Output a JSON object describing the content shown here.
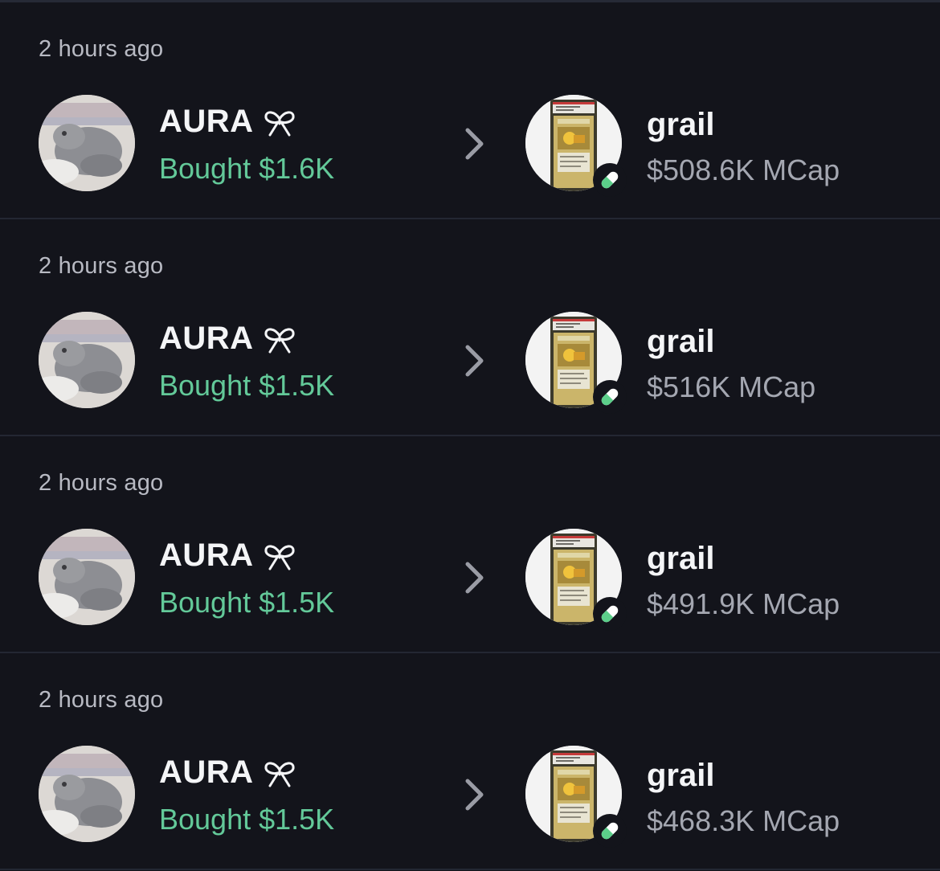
{
  "colors": {
    "background": "#13141b",
    "divider": "#232733",
    "action_green": "#63c999",
    "muted_text": "#a4a7b1",
    "primary_text": "#f4f5f7"
  },
  "icons": {
    "trader_badge": "ribbon-icon",
    "arrow": "chevron-right-icon",
    "token_badge": "pill-icon"
  },
  "trades": [
    {
      "time": "2 hours ago",
      "trader": "AURA",
      "action": "Bought $1.6K",
      "token": "grail",
      "mcap": "$508.6K MCap"
    },
    {
      "time": "2 hours ago",
      "trader": "AURA",
      "action": "Bought $1.5K",
      "token": "grail",
      "mcap": "$516K MCap"
    },
    {
      "time": "2 hours ago",
      "trader": "AURA",
      "action": "Bought $1.5K",
      "token": "grail",
      "mcap": "$491.9K MCap"
    },
    {
      "time": "2 hours ago",
      "trader": "AURA",
      "action": "Bought $1.5K",
      "token": "grail",
      "mcap": "$468.3K MCap"
    }
  ]
}
